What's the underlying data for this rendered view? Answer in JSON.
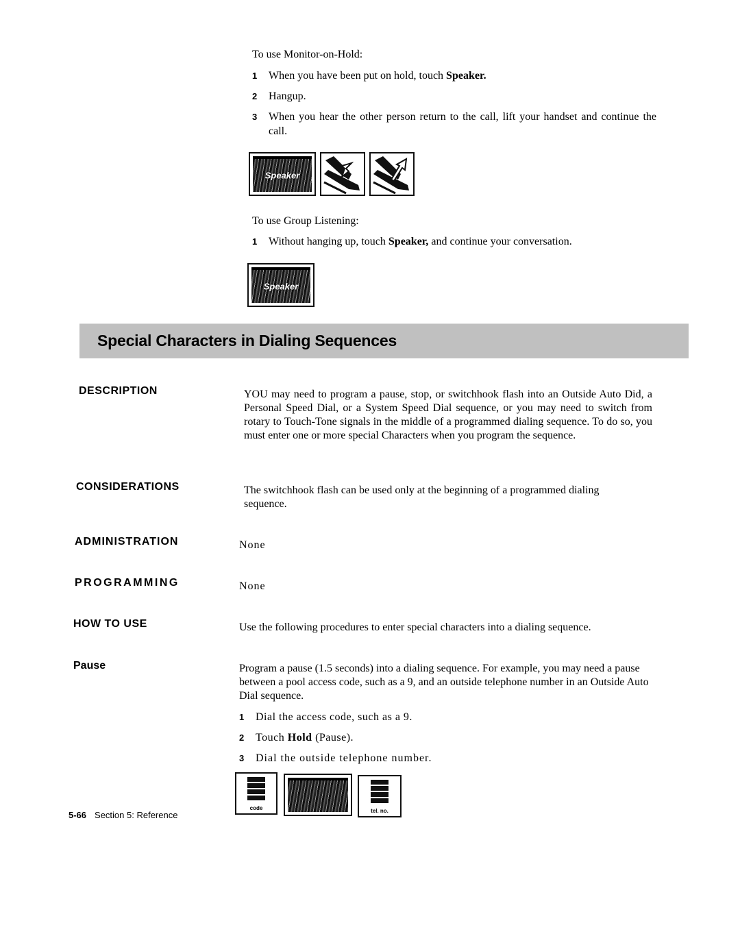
{
  "monitor_on_hold": {
    "intro": "To use Monitor-on-Hold:",
    "steps": [
      {
        "num": "1",
        "pre": "When you have been put on hold, touch ",
        "bold": "Speaker.",
        "post": ""
      },
      {
        "num": "2",
        "pre": "Hangup.",
        "bold": "",
        "post": ""
      },
      {
        "num": "3",
        "pre": "When you hear the other person return to the call, lift your handset and continue the call.",
        "bold": "",
        "post": ""
      }
    ],
    "icons": {
      "speaker_label": "Speaker",
      "handset_down": "handset-down-icon",
      "handset_up": "handset-up-icon"
    }
  },
  "group_listening": {
    "intro": "To use Group Listening:",
    "steps": [
      {
        "num": "1",
        "pre": "Without hanging up, touch ",
        "bold": "Speaker,",
        "post": " and continue your conversation."
      }
    ],
    "icons": {
      "speaker_label": "Speaker"
    }
  },
  "section": {
    "title": "Special Characters in Dialing Sequences",
    "band_color": "#c0c0c0"
  },
  "description": {
    "label": "DESCRIPTION",
    "text": "YOU may need to program a pause, stop, or switchhook flash into an Outside Auto Did, a Personal Speed Dial, or a System Speed Dial sequence, or you may need to switch from rotary to Touch-Tone signals in the middle of a programmed dialing sequence. To do so, you must enter one or more special Characters when you program the sequence."
  },
  "considerations": {
    "label": "CONSIDERATIONS",
    "text": "The switchhook flash can be used only at the beginning of a programmed dialing sequence."
  },
  "administration": {
    "label": "ADMINISTRATION",
    "text": "None"
  },
  "programming": {
    "label": "PROGRAMMING",
    "text": "None"
  },
  "how_to_use": {
    "label": "HOW TO USE",
    "text": "Use the following procedures to enter special characters into a dialing sequence."
  },
  "pause": {
    "label": "Pause",
    "text": "Program a pause (1.5 seconds) into a dialing sequence. For example, you may need a pause between a pool access code, such as a 9, and an outside telephone number in an Outside Auto Dial sequence.",
    "steps": [
      {
        "num": "1",
        "pre": "Dial the access code, such as a 9.",
        "bold": "",
        "post": ""
      },
      {
        "num": "2",
        "pre": "Touch ",
        "bold": "Hold",
        "post": " (Pause)."
      },
      {
        "num": "3",
        "pre": "Dial the outside telephone number.",
        "bold": "",
        "post": ""
      }
    ],
    "icons": {
      "code_label": "code",
      "telno_label": "tel. no."
    }
  },
  "footer": {
    "page": "5-66",
    "section": "Section 5: Reference"
  }
}
